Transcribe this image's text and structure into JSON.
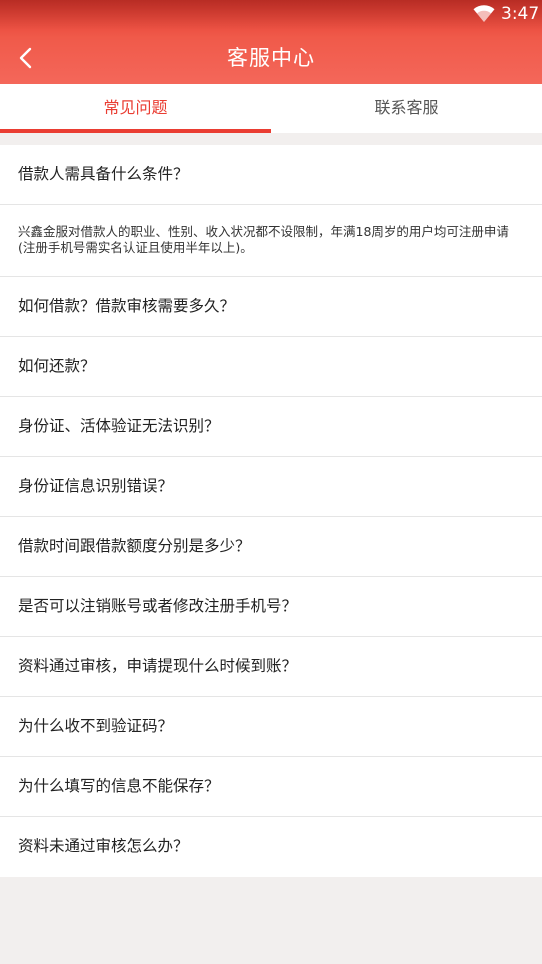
{
  "status_bar": {
    "time": "3:47",
    "wifi_icon": "wifi-icon"
  },
  "header": {
    "title": "客服中心",
    "back_icon": "chevron-left-icon"
  },
  "tabs": [
    {
      "label": "常见问题",
      "active": true
    },
    {
      "label": "联系客服",
      "active": false
    }
  ],
  "faq": {
    "q1": "借款人需具备什么条件？",
    "a1": "兴鑫金服对借款人的职业、性别、收入状况都不设限制，年满18周岁的用户均可注册申请(注册手机号需实名认证且使用半年以上)。",
    "q2": "如何借款？借款审核需要多久？",
    "q3": "如何还款？",
    "q4": "身份证、活体验证无法识别？",
    "q5": "身份证信息识别错误？",
    "q6": "借款时间跟借款额度分别是多少？",
    "q7": "是否可以注销账号或者修改注册手机号？",
    "q8": "资料通过审核，申请提现什么时候到账？",
    "q9": "为什么收不到验证码？",
    "q10": "为什么填写的信息不能保存？",
    "q11": "资料未通过审核怎么办？"
  },
  "colors": {
    "accent": "#ea3d32",
    "header_top": "#e0362c",
    "header_bottom": "#f4675a",
    "background": "#f2efee"
  }
}
